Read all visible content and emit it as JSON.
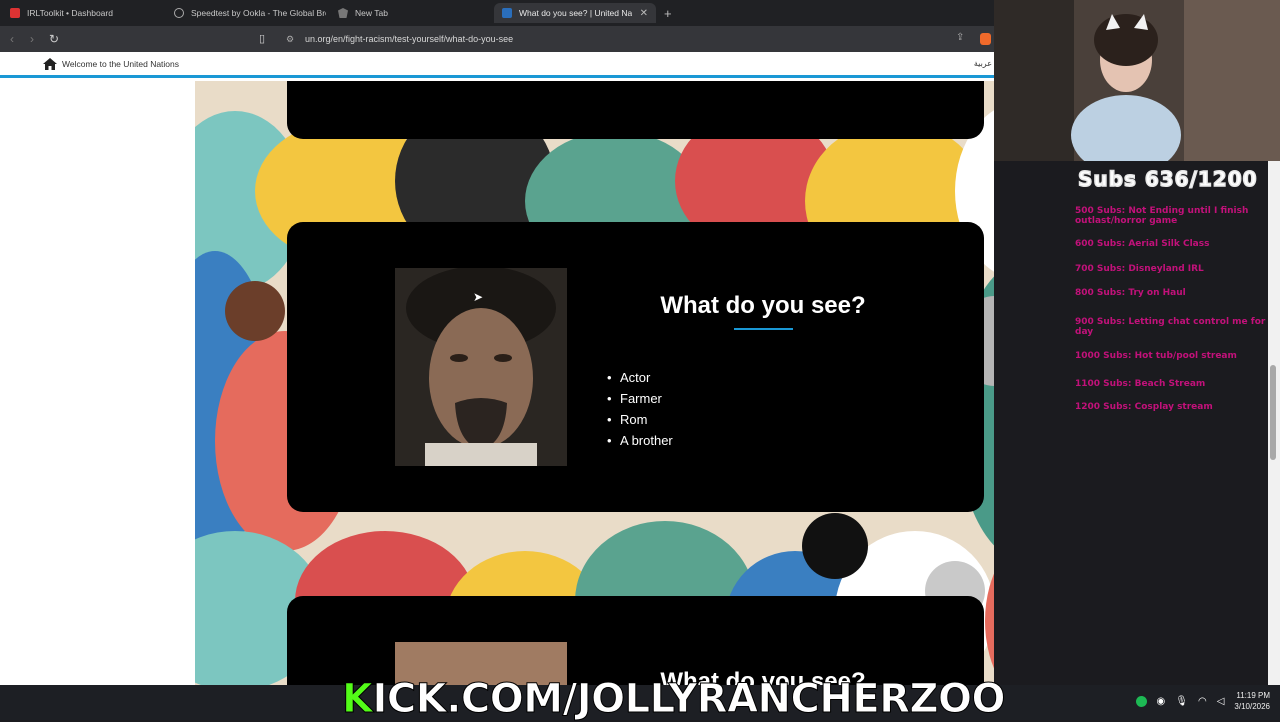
{
  "tabs": [
    {
      "label": "IRLToolkit • Dashboard",
      "favicon_color": "#d33"
    },
    {
      "label": "Speedtest by Ookla - The Global Bro",
      "favicon_color": "#888"
    },
    {
      "label": "New Tab",
      "favicon_color": "#aaa"
    },
    {
      "label": "What do you see? | United Natio",
      "favicon_color": "#2a6ebb"
    }
  ],
  "address_bar": {
    "url": "un.org/en/fight-racism/test-yourself/what-do-you-see"
  },
  "un_header": {
    "welcome": "Welcome to the United Nations",
    "lang": "عربية"
  },
  "quiz": {
    "question": "What do you see?",
    "options": [
      "Actor",
      "Farmer",
      "Rom",
      "A brother"
    ],
    "next_question": "What do you see?"
  },
  "stream_overlay": {
    "goal_title": "Subs 636/1200",
    "goals": [
      "500 Subs: Not Ending until I finish outlast/horror game",
      "600 Subs: Aerial Silk Class",
      "700 Subs: Disneyland IRL",
      "800 Subs: Try on Haul",
      "900 Subs: Letting chat control me for a day",
      "1000 Subs: Hot tub/pool stream",
      "1100 Subs: Beach Stream",
      "1200 Subs: Cosplay stream"
    ],
    "banner_k": "K",
    "banner_rest": "ICK.COM/JOLLYRANCHERZOO"
  },
  "system": {
    "time": "11:19 PM",
    "date": "3/10/2026"
  },
  "colors": {
    "un_blue": "#1a98d5",
    "kick_green": "#53fc18",
    "goal_pink": "#c2117a"
  }
}
